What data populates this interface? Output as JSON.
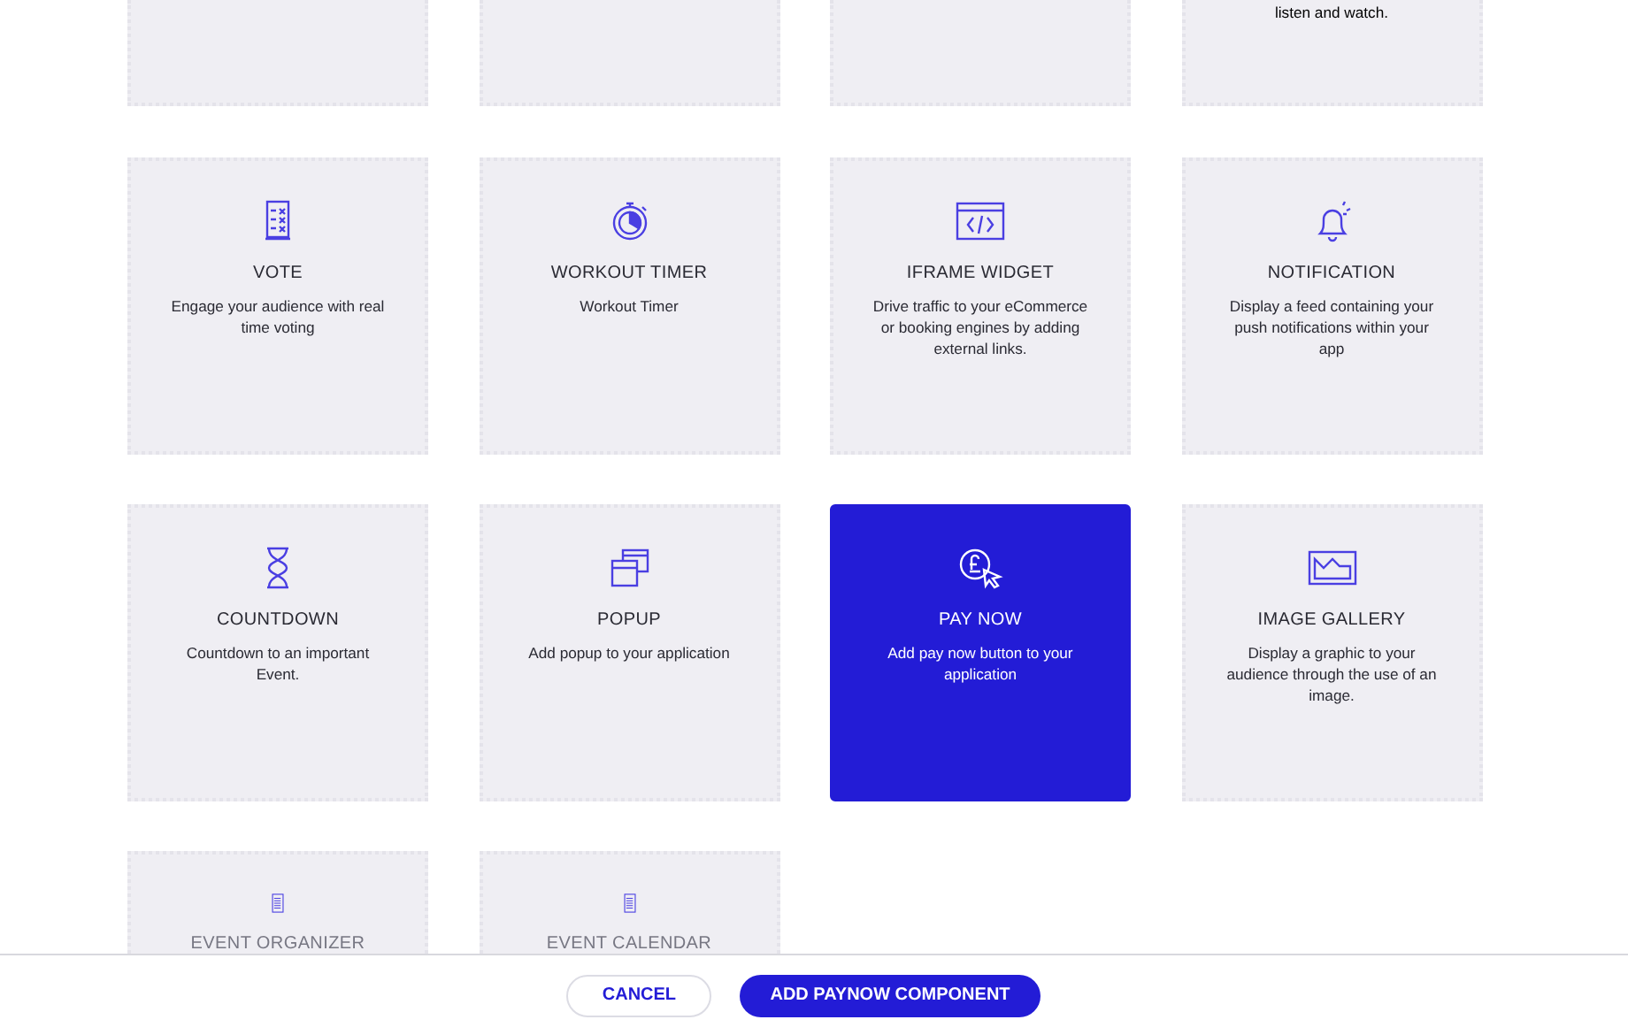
{
  "top_row": {
    "last_card_description": "listen and watch."
  },
  "cards": [
    {
      "title": "VOTE",
      "description": "Engage your audience with real time voting",
      "selected": false
    },
    {
      "title": "WORKOUT TIMER",
      "description": "Workout Timer",
      "selected": false
    },
    {
      "title": "IFRAME WIDGET",
      "description": "Drive traffic to your eCommerce or booking engines by adding external links.",
      "selected": false
    },
    {
      "title": "NOTIFICATION",
      "description": "Display a feed containing your push notifications within your app",
      "selected": false
    },
    {
      "title": "COUNTDOWN",
      "description": "Countdown to an important Event.",
      "selected": false
    },
    {
      "title": "POPUP",
      "description": "Add popup to your application",
      "selected": false
    },
    {
      "title": "PAY NOW",
      "description": "Add pay now button to your application",
      "selected": true
    },
    {
      "title": "IMAGE GALLERY",
      "description": "Display a graphic to your audience through the use of an image.",
      "selected": false
    },
    {
      "title": "EVENT ORGANIZER",
      "selected": false
    },
    {
      "title": "EVENT CALENDAR",
      "selected": false
    }
  ],
  "footer": {
    "cancel": "CANCEL",
    "confirm": "ADD PAYNOW COMPONENT"
  }
}
